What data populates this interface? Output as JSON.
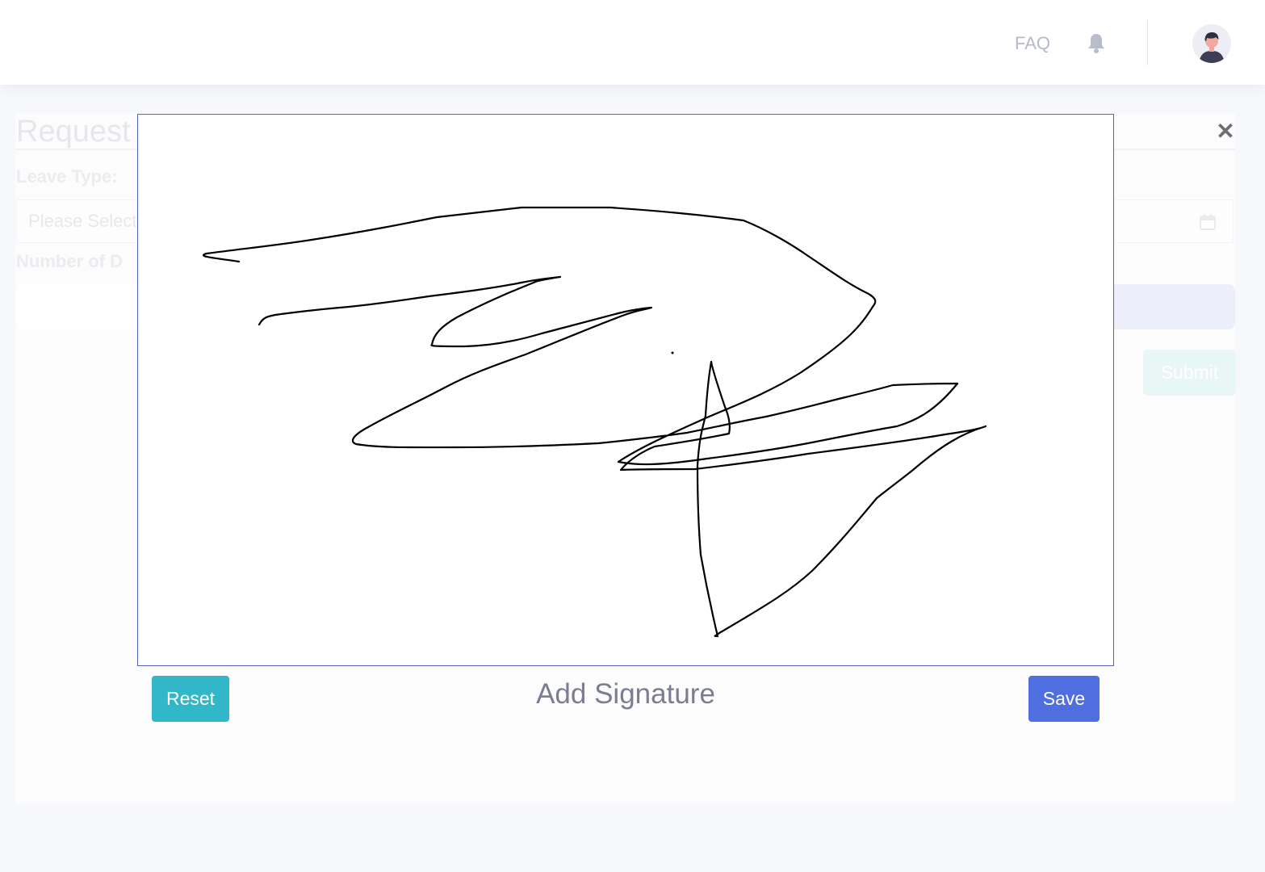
{
  "header": {
    "faq_label": "FAQ",
    "icons": [
      "bell-icon",
      "user-avatar"
    ]
  },
  "background_form": {
    "title": "Request L",
    "leave_type_label": "Leave Type:",
    "leave_type_placeholder": "Please Select",
    "days_label": "Number of D",
    "submit_label": "Submit",
    "icons": [
      "calendar-icon",
      "close-icon"
    ]
  },
  "signature_modal": {
    "title": "Add Signature",
    "reset_label": "Reset",
    "save_label": "Save"
  },
  "colors": {
    "reset": "#32b7c9",
    "save": "#4f6fe0",
    "canvas_border": "#5064c8",
    "stroke": "#000000"
  }
}
